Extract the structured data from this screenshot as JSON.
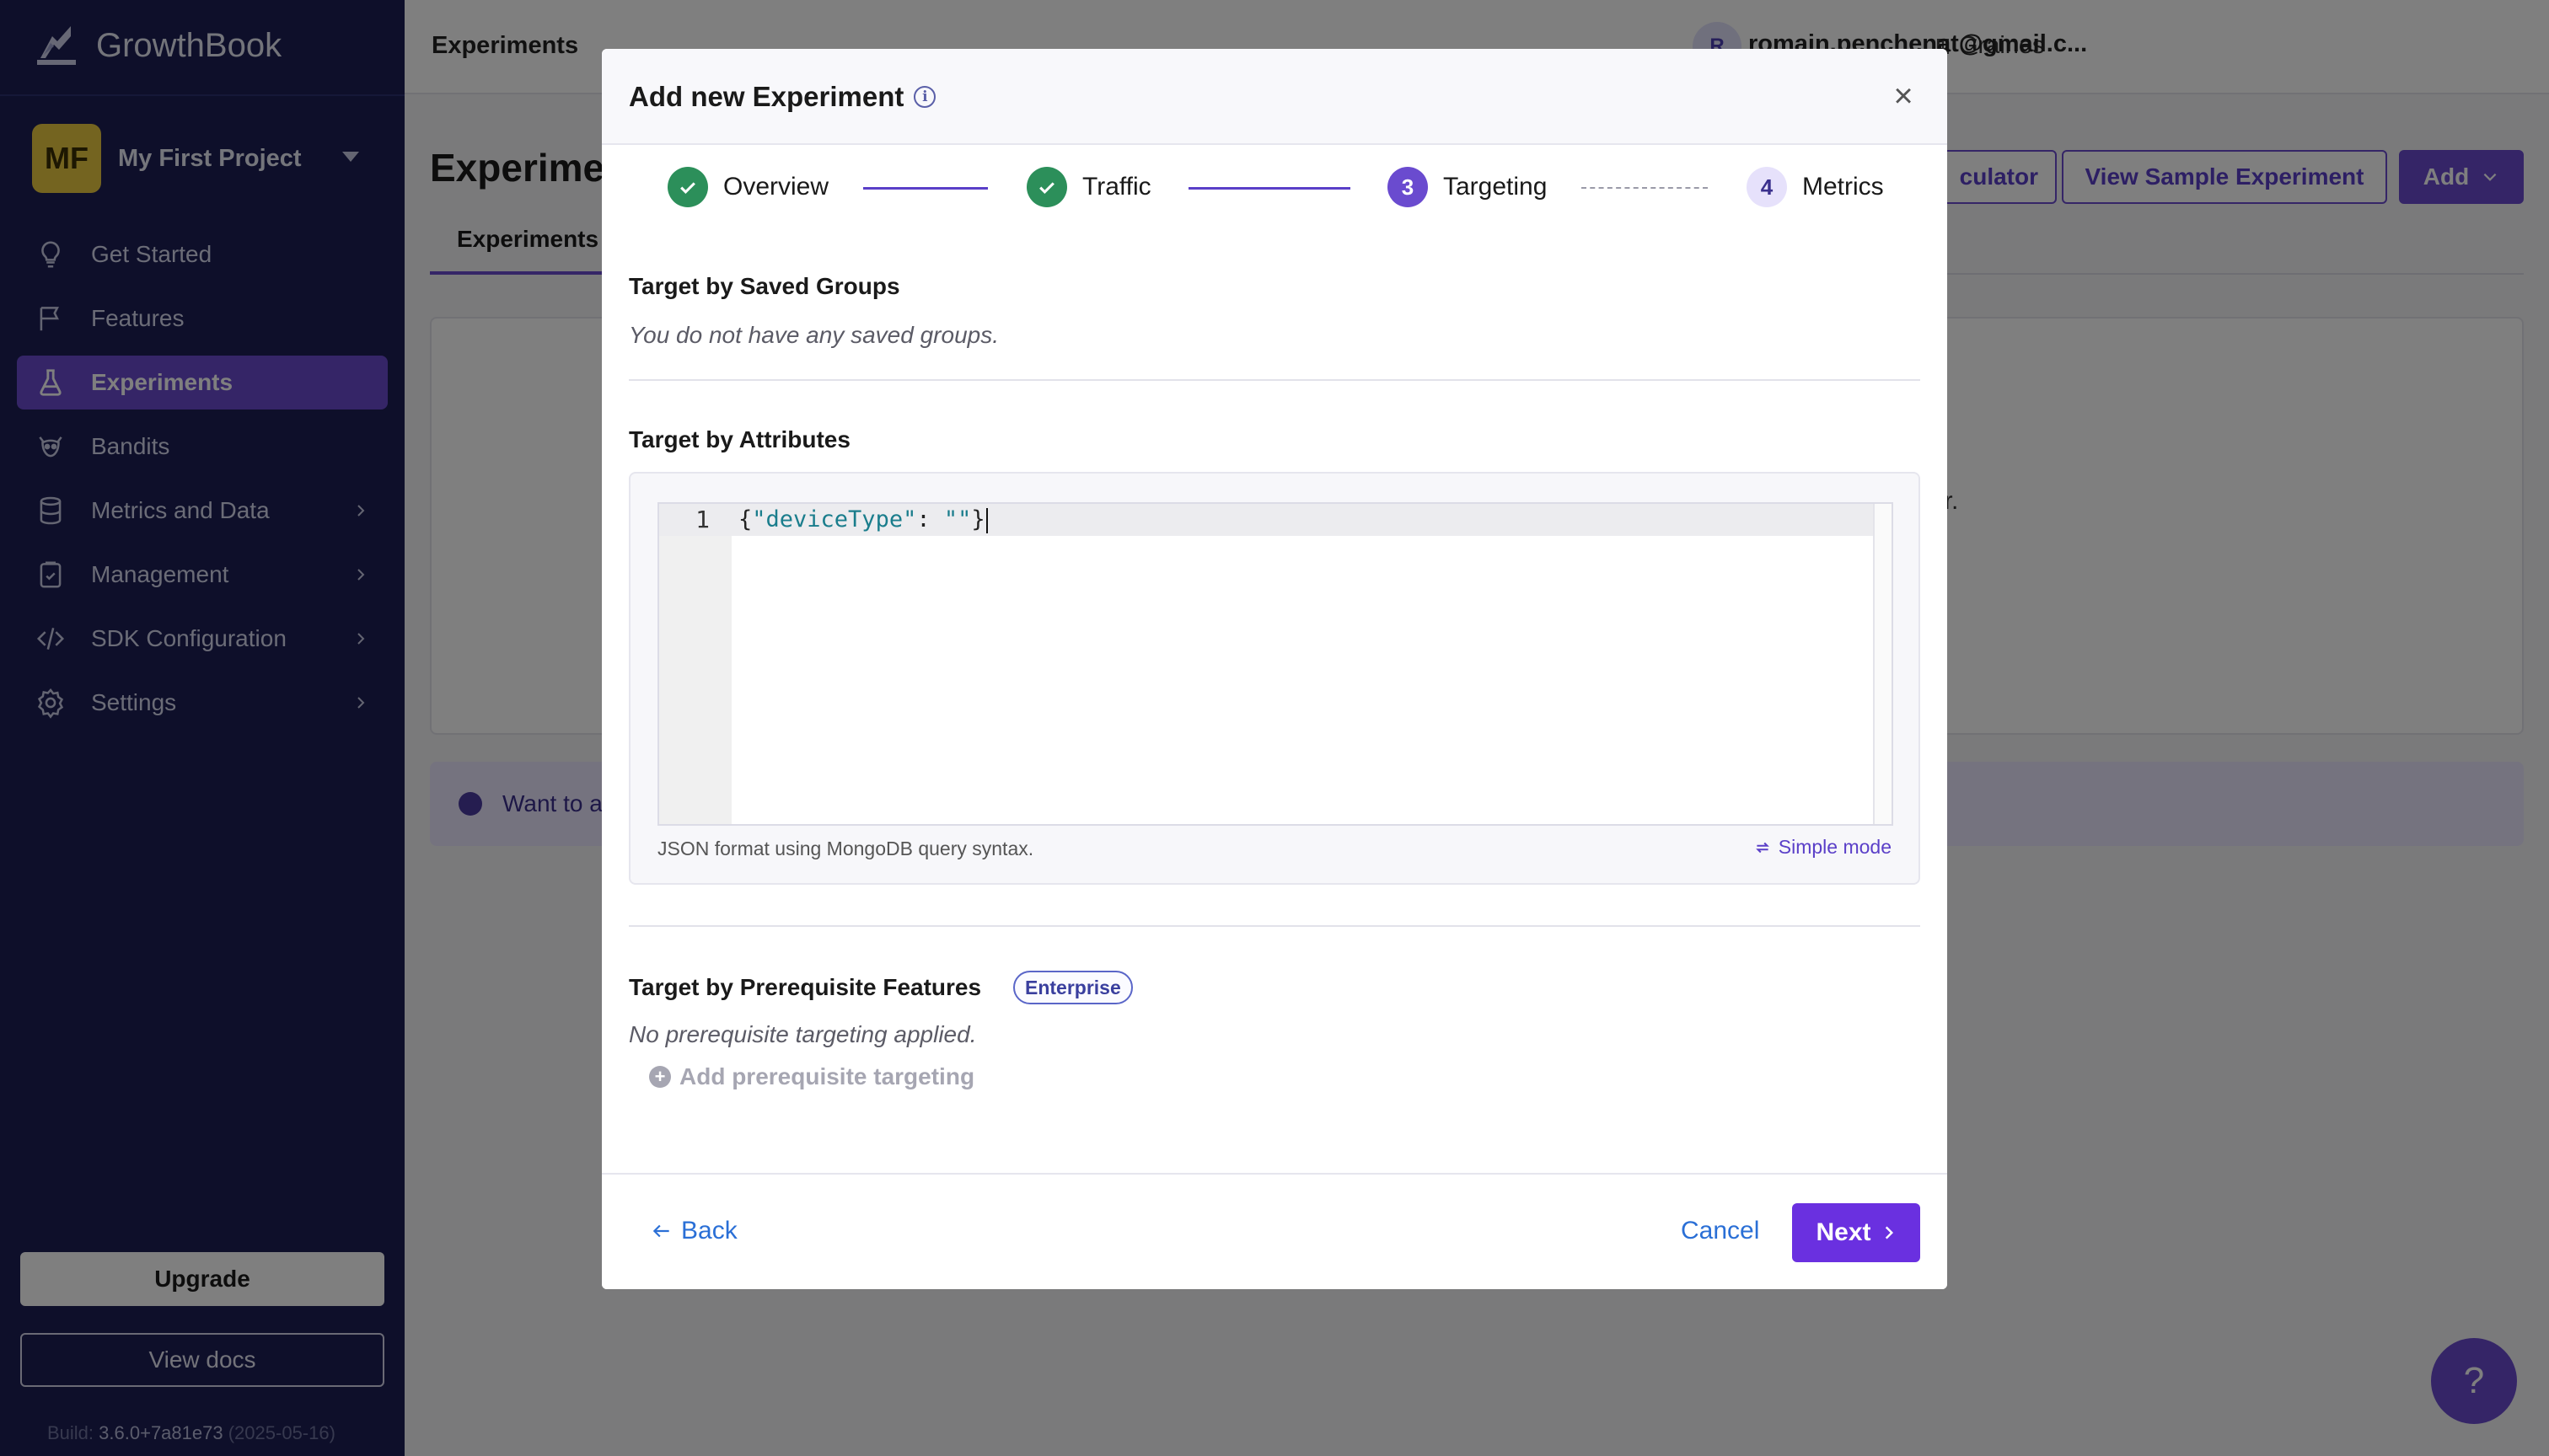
{
  "app": {
    "brand": "GrowthBook"
  },
  "sidebar": {
    "project": {
      "initials": "MF",
      "name": "My First Project"
    },
    "items": [
      {
        "label": "Get Started",
        "icon": "lightbulb-icon"
      },
      {
        "label": "Features",
        "icon": "flag-icon"
      },
      {
        "label": "Experiments",
        "icon": "flask-icon",
        "active": true
      },
      {
        "label": "Bandits",
        "icon": "raccoon-icon"
      },
      {
        "label": "Metrics and Data",
        "icon": "database-icon",
        "has_submenu": true
      },
      {
        "label": "Management",
        "icon": "clipboard-icon",
        "has_submenu": true
      },
      {
        "label": "SDK Configuration",
        "icon": "code-icon",
        "has_submenu": true
      },
      {
        "label": "Settings",
        "icon": "gear-icon",
        "has_submenu": true
      }
    ],
    "upgrade_label": "Upgrade",
    "docs_label": "View docs",
    "build": {
      "prefix": "Build:",
      "version": "3.6.0+7a81e73",
      "date": "(2025-05-16)"
    }
  },
  "topbar": {
    "title": "Experiments",
    "org": "Graines",
    "user_initial": "R",
    "user_email": "romain.penchenat@gmail.c..."
  },
  "page": {
    "heading": "Experime",
    "buttons": {
      "calculator": "culator",
      "sample": "View Sample Experiment",
      "add": "Add"
    },
    "tab": "Experiments",
    "empty_text": "or.",
    "banner_text": "Want to a"
  },
  "modal": {
    "title": "Add new Experiment",
    "steps": [
      {
        "label": "Overview",
        "state": "done"
      },
      {
        "label": "Traffic",
        "state": "done"
      },
      {
        "number": "3",
        "label": "Targeting",
        "state": "current"
      },
      {
        "number": "4",
        "label": "Metrics",
        "state": "todo"
      }
    ],
    "saved_groups": {
      "title": "Target by Saved Groups",
      "note": "You do not have any saved groups."
    },
    "attributes": {
      "title": "Target by Attributes",
      "editor": {
        "line_number": "1",
        "code_open": "{",
        "code_key": "\"deviceType\"",
        "code_colon": ": ",
        "code_value": "\"\"",
        "code_close": "}"
      },
      "hint": "JSON format using MongoDB query syntax.",
      "simple_mode": "Simple mode"
    },
    "prerequisites": {
      "title": "Target by Prerequisite Features",
      "badge": "Enterprise",
      "note": "No prerequisite targeting applied.",
      "add_label": "Add prerequisite targeting"
    },
    "footer": {
      "back": "Back",
      "cancel": "Cancel",
      "next": "Next"
    }
  },
  "help_fab": "?",
  "colors": {
    "sidebar_bg": "#1c1f55",
    "accent": "#6a4bcf",
    "done": "#2c8f5a",
    "link": "#2a6fd6",
    "next_bg": "#6a30e0"
  }
}
